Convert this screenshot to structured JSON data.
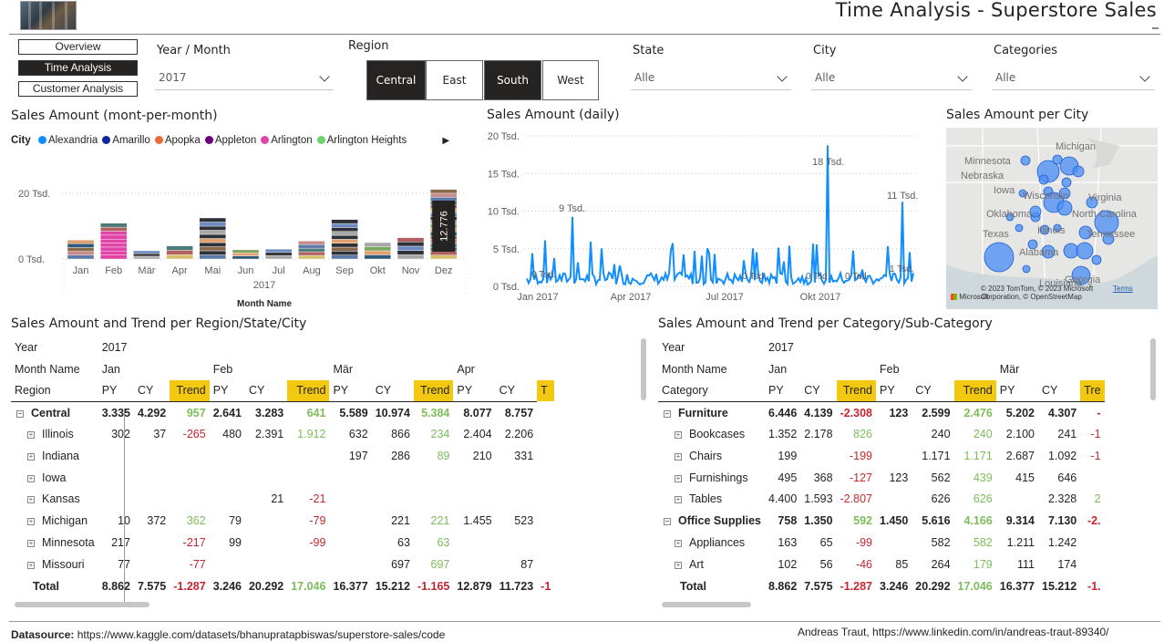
{
  "header": {
    "title": "Time Analysis - Superstore Sales"
  },
  "nav": {
    "items": [
      "Overview",
      "Time Analysis",
      "Customer Analysis"
    ],
    "active": "Time Analysis"
  },
  "filters": {
    "year_month": {
      "label": "Year / Month",
      "value": "2017"
    },
    "region": {
      "label": "Region",
      "options": [
        "Central",
        "East",
        "South",
        "West"
      ],
      "selected": [
        "Central",
        "South"
      ]
    },
    "state": {
      "label": "State",
      "value": "Alle"
    },
    "city": {
      "label": "City",
      "value": "Alle"
    },
    "categories": {
      "label": "Categories",
      "value": "Alle"
    }
  },
  "monthly_chart": {
    "title": "Sales Amount (mont-per-month)",
    "legend_title": "City",
    "legend": [
      {
        "name": "Alexandria",
        "color": "#118dff"
      },
      {
        "name": "Amarillo",
        "color": "#12239e"
      },
      {
        "name": "Apopka",
        "color": "#e66c37"
      },
      {
        "name": "Appleton",
        "color": "#6b007b"
      },
      {
        "name": "Arlington",
        "color": "#e044a7"
      },
      {
        "name": "Arlington Heights",
        "color": "#6bd36b"
      }
    ],
    "tick_20": "20 Tsd.",
    "tick_0": "0 Tsd.",
    "year_label": "2017",
    "xlabel": "Month Name",
    "highlight_label": "12.776"
  },
  "chart_data": [
    {
      "type": "bar",
      "title": "Sales Amount (mont-per-month)",
      "xlabel": "Month Name",
      "ylabel": "",
      "categories": [
        "Jan",
        "Feb",
        "Mär",
        "Apr",
        "Mai",
        "Jun",
        "Jul",
        "Aug",
        "Sep",
        "Okt",
        "Nov",
        "Dez"
      ],
      "values": [
        5.8,
        10.9,
        2.5,
        4.0,
        12.5,
        2.8,
        3.0,
        5.5,
        12.0,
        5.0,
        6.5,
        21.2
      ],
      "ylim": [
        0,
        25
      ],
      "data_labels": {
        "Dez": "12.776"
      }
    },
    {
      "type": "line",
      "title": "Sales Amount (daily)",
      "x_ticks": [
        "Jan 2017",
        "Apr 2017",
        "Jul 2017",
        "Okt 2017"
      ],
      "y_ticks": [
        "0 Tsd.",
        "5 Tsd.",
        "10 Tsd.",
        "15 Tsd.",
        "20 Tsd."
      ],
      "ylim": [
        0,
        20
      ],
      "annotations": [
        "9 Tsd.",
        "18 Tsd.",
        "11 Tsd.",
        "0 Tsd.",
        "0 Tsd.",
        "0 Tsd.",
        "0 Tsd.",
        "1 Tsd."
      ],
      "peaks": [
        {
          "x": "Jan 2017",
          "y": 9
        },
        {
          "x": "Okt 2017",
          "y": 18
        },
        {
          "x": "Dez 2017",
          "y": 11
        }
      ]
    }
  ],
  "daily_chart": {
    "title": "Sales Amount (daily)",
    "yticks": [
      "20 Tsd.",
      "15 Tsd.",
      "10 Tsd.",
      "5 Tsd.",
      "0 Tsd."
    ],
    "xticks": [
      "Jan 2017",
      "Apr 2017",
      "Jul 2017",
      "Okt 2017"
    ],
    "labels": {
      "p1": "9 Tsd.",
      "p2": "18 Tsd.",
      "p3": "11 Tsd.",
      "z1": "0 Tsd.",
      "z2": "0 Tsd.",
      "z3": "0 Tsd.",
      "z4": "0 Tsd.",
      "z5": "1 Tsd."
    }
  },
  "map": {
    "title": "Sales Amount per City",
    "places": [
      "Michigan",
      "Minnesota",
      "Nebraska",
      "Iowa",
      "Wisconsin",
      "Virginia",
      "Oklahoma",
      "Illinois",
      "North Carolina",
      "Texas",
      "Alabama",
      "Tennessee",
      "Georgia",
      "Louisiana"
    ],
    "copyright": "© 2023 TomTom, © 2023 Microsoft Corporation, © OpenStreetMap",
    "terms": "Terms",
    "brand": "Microsoft"
  },
  "region_table": {
    "title": "Sales Amount and Trend per Region/State/City",
    "year_label": "Year",
    "year_value": "2017",
    "month_label": "Month Name",
    "row_label": "Region",
    "months": [
      "Jan",
      "Feb",
      "Mär",
      "Apr"
    ],
    "col_headers": [
      "PY",
      "CY",
      "Trend"
    ],
    "rows": [
      {
        "name": "Central",
        "level": 0,
        "bold": true,
        "vals": [
          "3.335",
          "4.292",
          "957",
          "2.641",
          "3.283",
          "641",
          "5.589",
          "10.974",
          "5.384",
          "8.077",
          "8.757"
        ]
      },
      {
        "name": "Illinois",
        "level": 1,
        "vals": [
          "302",
          "37",
          "-265",
          "480",
          "2.391",
          "1.912",
          "632",
          "866",
          "234",
          "2.404",
          "2.206"
        ]
      },
      {
        "name": "Indiana",
        "level": 1,
        "vals": [
          "",
          "",
          "",
          "",
          "",
          "",
          "197",
          "286",
          "89",
          "210",
          "331"
        ]
      },
      {
        "name": "Iowa",
        "level": 1,
        "vals": [
          "",
          "",
          "",
          "",
          "",
          "",
          "",
          "",
          "",
          "",
          ""
        ]
      },
      {
        "name": "Kansas",
        "level": 1,
        "vals": [
          "",
          "",
          "",
          "",
          "21",
          "-21",
          "",
          "",
          "",
          "",
          ""
        ]
      },
      {
        "name": "Michigan",
        "level": 1,
        "vals": [
          "10",
          "372",
          "362",
          "79",
          "",
          "-79",
          "",
          "221",
          "221",
          "1.455",
          "523"
        ]
      },
      {
        "name": "Minnesota",
        "level": 1,
        "vals": [
          "217",
          "",
          "-217",
          "99",
          "",
          "-99",
          "",
          "63",
          "63",
          "",
          ""
        ]
      },
      {
        "name": "Missouri",
        "level": 1,
        "vals": [
          "77",
          "",
          "-77",
          "",
          "",
          "",
          "",
          "697",
          "697",
          "",
          "87"
        ]
      },
      {
        "name": "Total",
        "level": -1,
        "bold": true,
        "vals": [
          "8.862",
          "7.575",
          "-1.287",
          "3.246",
          "20.292",
          "17.046",
          "16.377",
          "15.212",
          "-1.165",
          "12.879",
          "11.723"
        ],
        "extra": "-1"
      }
    ]
  },
  "category_table": {
    "title": "Sales Amount and Trend per Category/Sub-Category",
    "year_label": "Year",
    "year_value": "2017",
    "month_label": "Month Name",
    "row_label": "Category",
    "months": [
      "Jan",
      "Feb",
      "Mär"
    ],
    "col_headers": [
      "PY",
      "CY",
      "Trend"
    ],
    "trend_cut": "Tre",
    "rows": [
      {
        "name": "Furniture",
        "level": 0,
        "bold": true,
        "vals": [
          "6.446",
          "4.139",
          "-2.308",
          "123",
          "2.599",
          "2.476",
          "5.202",
          "4.307"
        ],
        "extra": "-"
      },
      {
        "name": "Bookcases",
        "level": 1,
        "vals": [
          "1.352",
          "2.178",
          "826",
          "",
          "240",
          "240",
          "2.100",
          "241"
        ],
        "extra": "-1"
      },
      {
        "name": "Chairs",
        "level": 1,
        "vals": [
          "199",
          "",
          "-199",
          "",
          "1.171",
          "1.171",
          "2.687",
          "1.092"
        ],
        "extra": "-1"
      },
      {
        "name": "Furnishings",
        "level": 1,
        "vals": [
          "495",
          "368",
          "-127",
          "123",
          "562",
          "439",
          "415",
          "646"
        ],
        "extra": ""
      },
      {
        "name": "Tables",
        "level": 1,
        "vals": [
          "4.400",
          "1.593",
          "-2.807",
          "",
          "626",
          "626",
          "",
          "2.328"
        ],
        "extra": "2"
      },
      {
        "name": "Office Supplies",
        "level": 0,
        "bold": true,
        "vals": [
          "758",
          "1.350",
          "592",
          "1.450",
          "5.616",
          "4.166",
          "9.314",
          "7.130"
        ],
        "extra": "-2."
      },
      {
        "name": "Appliances",
        "level": 1,
        "vals": [
          "163",
          "65",
          "-99",
          "",
          "582",
          "582",
          "1.211",
          "1.242"
        ],
        "extra": ""
      },
      {
        "name": "Art",
        "level": 1,
        "vals": [
          "102",
          "56",
          "-46",
          "85",
          "264",
          "179",
          "111",
          "174"
        ],
        "extra": ""
      },
      {
        "name": "Total",
        "level": -1,
        "bold": true,
        "vals": [
          "8.862",
          "7.575",
          "-1.287",
          "3.246",
          "20.292",
          "17.046",
          "16.377",
          "15.212"
        ],
        "extra": "-1."
      }
    ]
  },
  "footer": {
    "datasource_label": "Datasource:",
    "datasource_url": "https://www.kaggle.com/datasets/bhanupratapbiswas/superstore-sales/code",
    "author": "Andreas Traut, https://www.linkedin.com/in/andreas-traut-89340/"
  }
}
